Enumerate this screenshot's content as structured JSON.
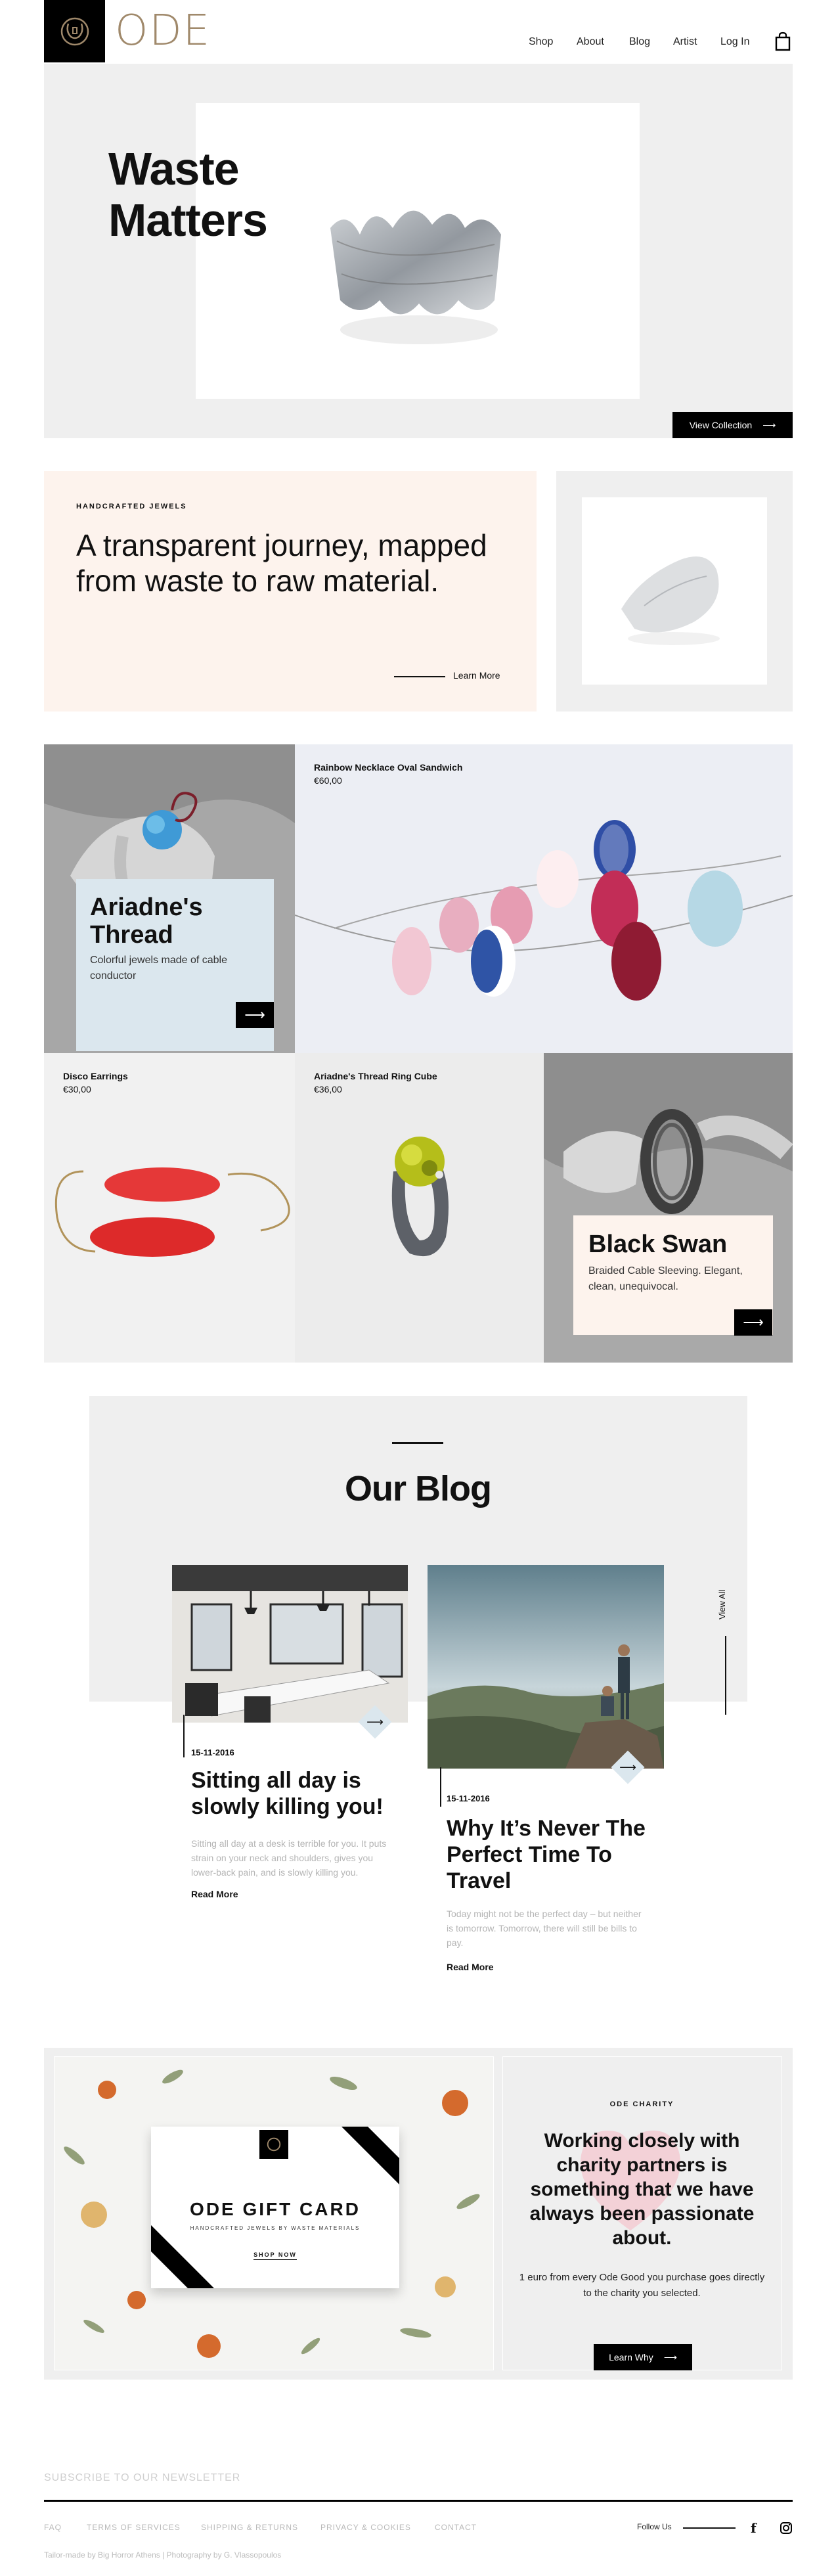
{
  "header": {
    "logo_text": "ODE",
    "nav": [
      "Shop",
      "About",
      "Blog",
      "Artist",
      "Log In"
    ]
  },
  "hero": {
    "title_line1": "Waste",
    "title_line2": "Matters",
    "cta": "View Collection"
  },
  "journey": {
    "eyebrow": "HANDCRAFTED JEWELS",
    "title": "A transparent journey, mapped from waste to raw material.",
    "link": "Learn More"
  },
  "products": {
    "ariadne": {
      "title": "Ariadne's Thread",
      "subtitle": "Colorful jewels made of cable conductor"
    },
    "rainbow": {
      "name": "Rainbow Necklace Oval Sandwich",
      "price": "€60,00"
    },
    "disco": {
      "name": "Disco Earrings",
      "price": "€30,00"
    },
    "ring_cube": {
      "name": "Ariadne's Thread Ring Cube",
      "price": "€36,00"
    },
    "black_swan": {
      "title": "Black Swan",
      "subtitle": "Braided Cable Sleeving. Elegant, clean, unequivocal."
    }
  },
  "blog": {
    "title": "Our Blog",
    "view_all": "View All",
    "posts": [
      {
        "date": "15-11-2016",
        "title": "Sitting all day is slowly killing you!",
        "excerpt": "Sitting all day at a desk is terrible for you. It puts strain on your neck and shoulders, gives you lower-back pain, and is slowly killing you.",
        "read_more": "Read More"
      },
      {
        "date": "15-11-2016",
        "title": "Why It’s Never The Perfect Time To Travel",
        "excerpt": "Today might not be the perfect day – but neither is tomorrow. Tomorrow, there will still be bills to pay.",
        "read_more": "Read More"
      }
    ]
  },
  "gift": {
    "title": "ODE GIFT CARD",
    "subtitle": "HANDCRAFTED JEWELS BY WASTE MATERIALS",
    "cta": "SHOP NOW"
  },
  "charity": {
    "eyebrow": "ODE CHARITY",
    "title": "Working closely with charity partners is something that we have always been passionate about.",
    "text": "1 euro from every Ode Good you purchase goes directly to the charity you selected.",
    "cta": "Learn Why"
  },
  "footer": {
    "newsletter": "SUBSCRIBE TO OUR NEWSLETTER",
    "links": [
      "FAQ",
      "TERMS OF SERVICES",
      "SHIPPING & RETURNS",
      "PRIVACY & COOKIES",
      "CONTACT"
    ],
    "follow": "Follow Us",
    "credits": "Tailor-made by Big Horror Athens | Photography by G. Vlassopoulos"
  },
  "colors": {
    "accent_gold": "#a0896b",
    "light_blue": "#dbe7ee",
    "peach": "#fdf3ed",
    "grey_bg": "#efefef"
  }
}
